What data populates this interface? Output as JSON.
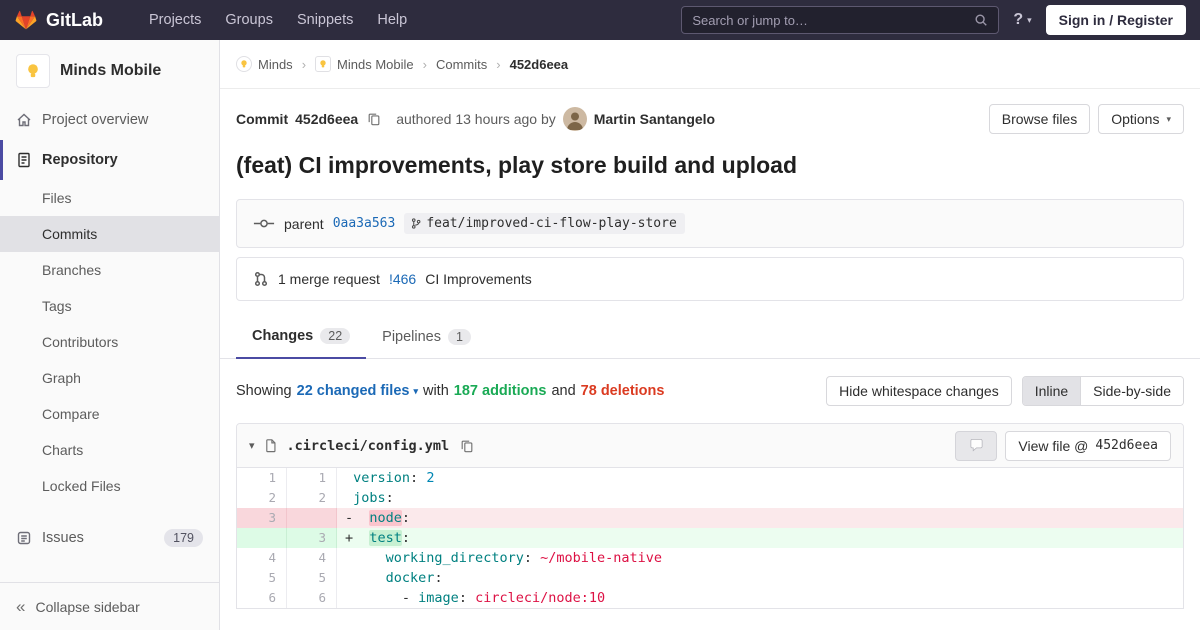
{
  "colors": {
    "navbar_bg": "#2e2c3e",
    "accent_indigo": "#4b4ba3",
    "link_blue": "#1b69b6",
    "addition_green": "#1aaa55",
    "deletion_red": "#db3b21"
  },
  "navbar": {
    "brand": "GitLab",
    "items": [
      {
        "label": "Projects"
      },
      {
        "label": "Groups"
      },
      {
        "label": "Snippets"
      },
      {
        "label": "Help"
      }
    ],
    "search_placeholder": "Search or jump to…",
    "help_glyph": "?",
    "signin_label": "Sign in / Register"
  },
  "sidebar": {
    "project_name": "Minds Mobile",
    "overview_label": "Project overview",
    "repository_label": "Repository",
    "repo_items": [
      {
        "label": "Files",
        "active": false
      },
      {
        "label": "Commits",
        "active": true
      },
      {
        "label": "Branches",
        "active": false
      },
      {
        "label": "Tags",
        "active": false
      },
      {
        "label": "Contributors",
        "active": false
      },
      {
        "label": "Graph",
        "active": false
      },
      {
        "label": "Compare",
        "active": false
      },
      {
        "label": "Charts",
        "active": false
      },
      {
        "label": "Locked Files",
        "active": false
      }
    ],
    "issues_label": "Issues",
    "issues_count": "179",
    "collapse_label": "Collapse sidebar"
  },
  "breadcrumb": {
    "items": [
      {
        "label": "Minds"
      },
      {
        "label": "Minds Mobile"
      },
      {
        "label": "Commits"
      }
    ],
    "current": "452d6eea"
  },
  "commit": {
    "label": "Commit",
    "sha": "452d6eea",
    "authored_text": "authored 13 hours ago by",
    "author_name": "Martin Santangelo",
    "browse_files_label": "Browse files",
    "options_label": "Options",
    "title": "(feat) CI improvements, play store build and upload",
    "parent_label": "parent",
    "parent_sha": "0aa3a563",
    "branch_name": "feat/improved-ci-flow-play-store",
    "mr_count_text": "1 merge request",
    "mr_ref": "!466",
    "mr_title": "CI Improvements"
  },
  "tabs": [
    {
      "label": "Changes",
      "count": "22",
      "active": true
    },
    {
      "label": "Pipelines",
      "count": "1",
      "active": false
    }
  ],
  "summary": {
    "showing_label": "Showing",
    "files_link": "22 changed files",
    "with_label": "with",
    "additions_text": "187 additions",
    "and_label": "and",
    "deletions_text": "78 deletions",
    "hide_whitespace_label": "Hide whitespace changes",
    "view_modes": [
      {
        "label": "Inline",
        "active": true
      },
      {
        "label": "Side-by-side",
        "active": false
      }
    ]
  },
  "diff": {
    "filename": ".circleci/config.yml",
    "view_file_prefix": "View file @",
    "view_file_sha": "452d6eea",
    "rows": [
      {
        "old": "1",
        "new": "1",
        "type": "context",
        "marker": " ",
        "code": [
          {
            "t": "version",
            "c": "key"
          },
          {
            "t": ": ",
            "c": "plain"
          },
          {
            "t": "2",
            "c": "num"
          }
        ]
      },
      {
        "old": "2",
        "new": "2",
        "type": "context",
        "marker": " ",
        "code": [
          {
            "t": "jobs",
            "c": "key"
          },
          {
            "t": ":",
            "c": "plain"
          }
        ]
      },
      {
        "old": "3",
        "new": "",
        "type": "del",
        "marker": "-",
        "code": [
          {
            "t": "  ",
            "c": "plain"
          },
          {
            "t": "node",
            "c": "key",
            "h": true
          },
          {
            "t": ":",
            "c": "plain"
          }
        ]
      },
      {
        "old": "",
        "new": "3",
        "type": "add",
        "marker": "+",
        "code": [
          {
            "t": "  ",
            "c": "plain"
          },
          {
            "t": "test",
            "c": "key",
            "h": true
          },
          {
            "t": ":",
            "c": "plain"
          }
        ]
      },
      {
        "old": "4",
        "new": "4",
        "type": "context",
        "marker": " ",
        "code": [
          {
            "t": "    ",
            "c": "plain"
          },
          {
            "t": "working_directory",
            "c": "key"
          },
          {
            "t": ": ",
            "c": "plain"
          },
          {
            "t": "~/mobile-native",
            "c": "str"
          }
        ]
      },
      {
        "old": "5",
        "new": "5",
        "type": "context",
        "marker": " ",
        "code": [
          {
            "t": "    ",
            "c": "plain"
          },
          {
            "t": "docker",
            "c": "key"
          },
          {
            "t": ":",
            "c": "plain"
          }
        ]
      },
      {
        "old": "6",
        "new": "6",
        "type": "context",
        "marker": " ",
        "code": [
          {
            "t": "      - ",
            "c": "plain"
          },
          {
            "t": "image",
            "c": "key"
          },
          {
            "t": ": ",
            "c": "plain"
          },
          {
            "t": "circleci/node:10",
            "c": "str"
          }
        ]
      }
    ]
  }
}
